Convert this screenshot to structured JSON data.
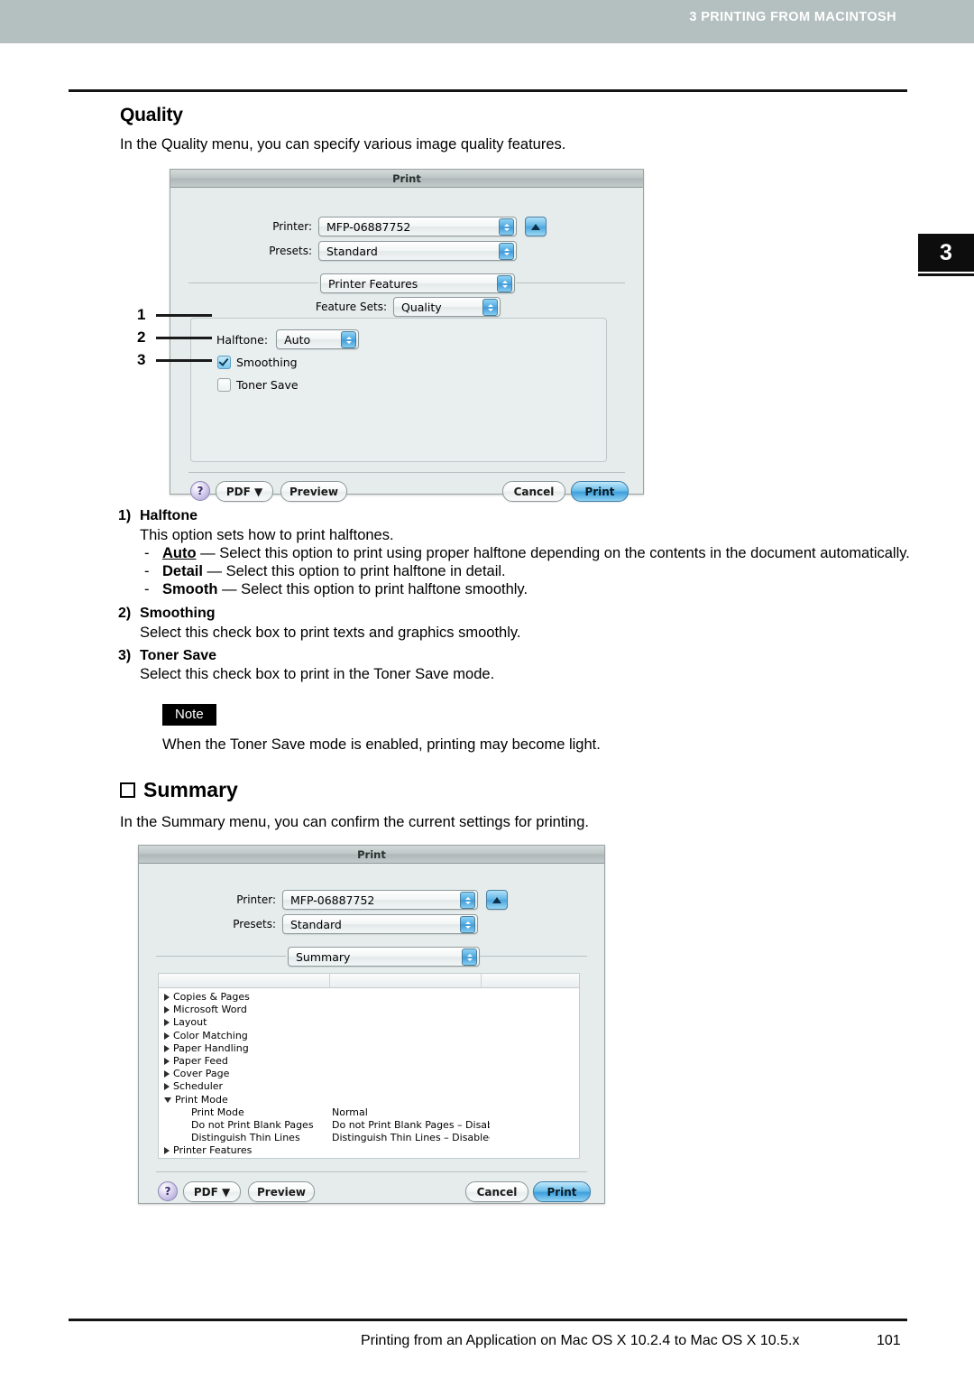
{
  "header": {
    "chapter_text": "3 PRINTING FROM MACINTOSH",
    "chapter_tab_number": "3",
    "bar_color": "#b4bfbf"
  },
  "quality_section": {
    "heading": "Quality",
    "intro": "In the Quality menu, you can specify various image quality features."
  },
  "quality_dialog": {
    "title": "Print",
    "printer_label": "Printer:",
    "printer_value": "MFP-06887752",
    "presets_label": "Presets:",
    "presets_value": "Standard",
    "pane_value": "Printer Features",
    "feature_sets_label": "Feature Sets:",
    "feature_sets_value": "Quality",
    "halftone_label": "Halftone:",
    "halftone_value": "Auto",
    "smoothing_label": "Smoothing",
    "smoothing_checked": true,
    "toner_save_label": "Toner Save",
    "toner_save_checked": false,
    "help_label": "?",
    "pdf_label": "PDF ▼",
    "preview_label": "Preview",
    "cancel_label": "Cancel",
    "print_label": "Print"
  },
  "callouts": [
    "1",
    "2",
    "3"
  ],
  "descriptions": [
    {
      "num": "1)",
      "title": "Halftone",
      "body": "This option sets how to print halftones.",
      "bullets": [
        {
          "dash": "-",
          "term": "Auto",
          "underlined": true,
          "text": " — Select this option to print using proper halftone depending on the contents in the document automatically."
        },
        {
          "dash": "-",
          "term": "Detail",
          "underlined": false,
          "text": " — Select this option to print halftone in detail."
        },
        {
          "dash": "-",
          "term": "Smooth",
          "underlined": false,
          "text": " — Select this option to print halftone smoothly."
        }
      ]
    },
    {
      "num": "2)",
      "title": "Smoothing",
      "body": "Select this check box to print texts and graphics smoothly.",
      "bullets": []
    },
    {
      "num": "3)",
      "title": "Toner Save",
      "body": "Select this check box to print in the Toner Save mode.",
      "bullets": []
    }
  ],
  "note": {
    "badge": "Note",
    "text": "When the Toner Save mode is enabled, printing may become light."
  },
  "summary_section": {
    "heading": "Summary",
    "intro": "In the Summary menu, you can confirm the current settings for printing."
  },
  "summary_dialog": {
    "title": "Print",
    "printer_label": "Printer:",
    "printer_value": "MFP-06887752",
    "presets_label": "Presets:",
    "presets_value": "Standard",
    "pane_value": "Summary",
    "list": [
      {
        "label": "Copies & Pages",
        "expanded": false
      },
      {
        "label": "Microsoft Word",
        "expanded": false
      },
      {
        "label": "Layout",
        "expanded": false
      },
      {
        "label": "Color Matching",
        "expanded": false
      },
      {
        "label": "Paper Handling",
        "expanded": false
      },
      {
        "label": "Paper Feed",
        "expanded": false
      },
      {
        "label": "Cover Page",
        "expanded": false
      },
      {
        "label": "Scheduler",
        "expanded": false
      },
      {
        "label": "Print Mode",
        "expanded": true
      },
      {
        "label": "Printer Features",
        "expanded": false
      }
    ],
    "print_mode_details": [
      {
        "key": "Print Mode",
        "value": "Normal"
      },
      {
        "key": "Do not Print Blank Pages",
        "value": "Do not Print Blank Pages – Disabled"
      },
      {
        "key": "Distinguish Thin Lines",
        "value": "Distinguish Thin Lines – Disabled"
      }
    ],
    "help_label": "?",
    "pdf_label": "PDF ▼",
    "preview_label": "Preview",
    "cancel_label": "Cancel",
    "print_label": "Print"
  },
  "footer": {
    "text": "Printing from an Application on Mac OS X 10.2.4 to Mac OS X 10.5.x",
    "page": "101"
  }
}
